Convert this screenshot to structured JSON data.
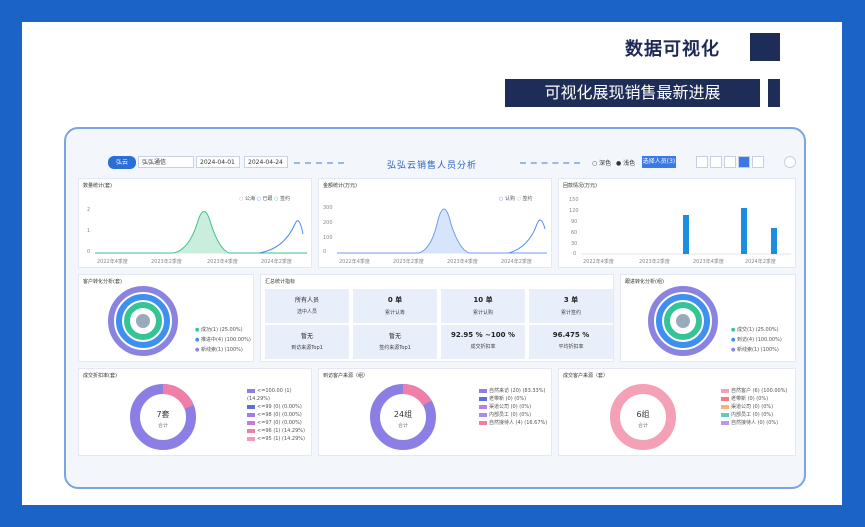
{
  "slide": {
    "title": "数据可视化",
    "subtitle": "可视化展现销售最新进展"
  },
  "dashboard": {
    "logo": "弘云",
    "org_select": "弘弘通信",
    "date_start": "2024-04-01",
    "date_end": "2024-04-24",
    "title": "弘弘云销售人员分析",
    "radio_options": [
      "深色",
      "浅色"
    ],
    "button": "选择人员(3)"
  },
  "panels": {
    "p1": {
      "title": "数量统计(套)",
      "legend": [
        "公海",
        "已跟",
        "签约"
      ],
      "x_labels": [
        "2022年4季度",
        "2023年2季度",
        "2023年4季度",
        "2024年2季度"
      ],
      "y_labels": [
        "2",
        "1",
        "0"
      ]
    },
    "p2": {
      "title": "金额统计(万元)",
      "legend": [
        "认购",
        "签约"
      ],
      "x_labels": [
        "2022年4季度",
        "2023年2季度",
        "2023年4季度",
        "2024年2季度"
      ],
      "y_labels": [
        "300",
        "200",
        "100",
        "0"
      ]
    },
    "p3": {
      "title": "回款情况(万元)",
      "x_labels": [
        "2022年4季度",
        "2023年2季度",
        "2023年4季度",
        "2024年2季度"
      ],
      "y_labels": [
        "150",
        "120",
        "90",
        "60",
        "30",
        "0"
      ]
    },
    "p4": {
      "title": "客户转化分析(套)",
      "legend": [
        "成功(1) (25.00%)",
        "推进中(4) (100.00%)",
        "新线索(1) (100%)"
      ]
    },
    "p5": {
      "title": "汇总统计指标",
      "cells": [
        {
          "v": "所有人员",
          "l": "选中人员"
        },
        {
          "v": "0 单",
          "l": "累计认筹"
        },
        {
          "v": "10 单",
          "l": "累计认购"
        },
        {
          "v": "3 单",
          "l": "累计签约"
        },
        {
          "v": "暂无",
          "l": "到访来源Top1"
        },
        {
          "v": "暂无",
          "l": "签约来源Top1"
        },
        {
          "v": "92.95 % ~100 %",
          "l": "成交折扣率"
        },
        {
          "v": "96.475 %",
          "l": "平均折扣率"
        }
      ]
    },
    "p6": {
      "title": "跟进转化分析(组)",
      "legend": [
        "成交(1) (25.00%)",
        "到访(4) (100.00%)",
        "新线索(1) (100%)"
      ]
    },
    "p7": {
      "title": "成交折扣率(套)",
      "center_value": "7套",
      "center_label": "合计",
      "legend": [
        "<=100.00 (1) (14.29%)",
        "<=99 (0) (0.00%)",
        "<=98 (0) (0.00%)",
        "<=97 (0) (0.00%)",
        "<=96 (1) (14.29%)",
        "<=95 (1) (14.29%)"
      ]
    },
    "p8": {
      "title": "到访客户来源（组）",
      "center_value": "24组",
      "center_label": "合计",
      "legend": [
        "自然来访 (20) (83.33%)",
        "老带新 (0) (0%)",
        "渠道公司 (0) (0%)",
        "内部员工 (0) (0%)",
        "自然接待人 (4) (16.67%)"
      ]
    },
    "p9": {
      "title": "成交客户来源（套）",
      "center_value": "6组",
      "center_label": "合计",
      "legend": [
        "自然客户 (6) (100.00%)",
        "老带新 (0) (0%)",
        "渠道公司 (0) (0%)",
        "内部员工 (0) (0%)",
        "自然接待人 (0) (0%)"
      ]
    }
  },
  "colors": {
    "frame": "#1b63c6",
    "navy": "#1e2d57",
    "accent": "#3a79e6"
  }
}
